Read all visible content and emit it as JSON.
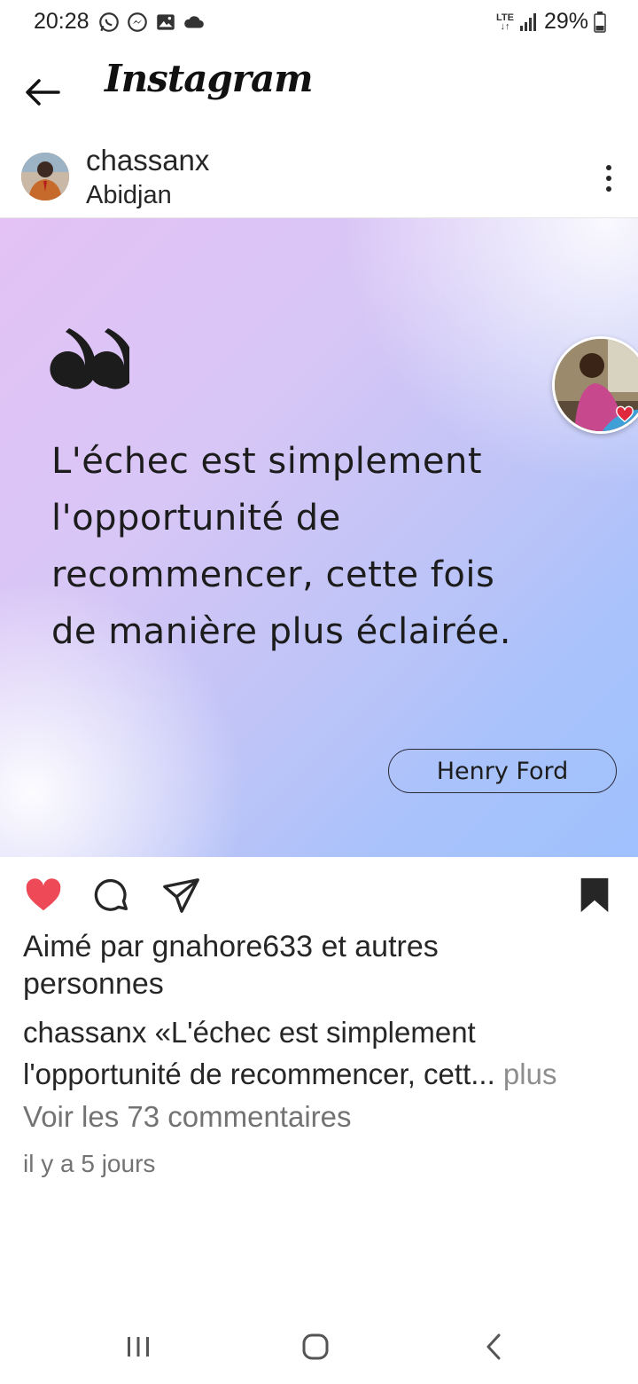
{
  "status_bar": {
    "time": "20:28",
    "network": "LTE",
    "battery": "29%",
    "icons": [
      "whatsapp-icon",
      "messenger-icon",
      "gallery-icon",
      "cloud-icon",
      "signal-icon",
      "battery-icon"
    ]
  },
  "header": {
    "app_name": "Instagram"
  },
  "post": {
    "username": "chassanx",
    "location": "Abidjan",
    "image": {
      "quote_lines": [
        "L'échec est simplement",
        "l'opportunité de",
        "recommencer, cette fois",
        "de manière plus éclairée."
      ],
      "author": "Henry Ford"
    },
    "liked": true,
    "saved": true,
    "likes_line1": "Aimé par gnahore633 et autres",
    "likes_line2": "personnes",
    "caption_line1": "chassanx «L'échec est simplement",
    "caption_line2": "l'opportunité de recommencer, cett...",
    "caption_more": " plus",
    "comments_link": "Voir les 73 commentaires",
    "timestamp": "il y a 5 jours"
  },
  "colors": {
    "like_red": "#ed4956",
    "text_primary": "#262626",
    "text_secondary": "#737373"
  }
}
